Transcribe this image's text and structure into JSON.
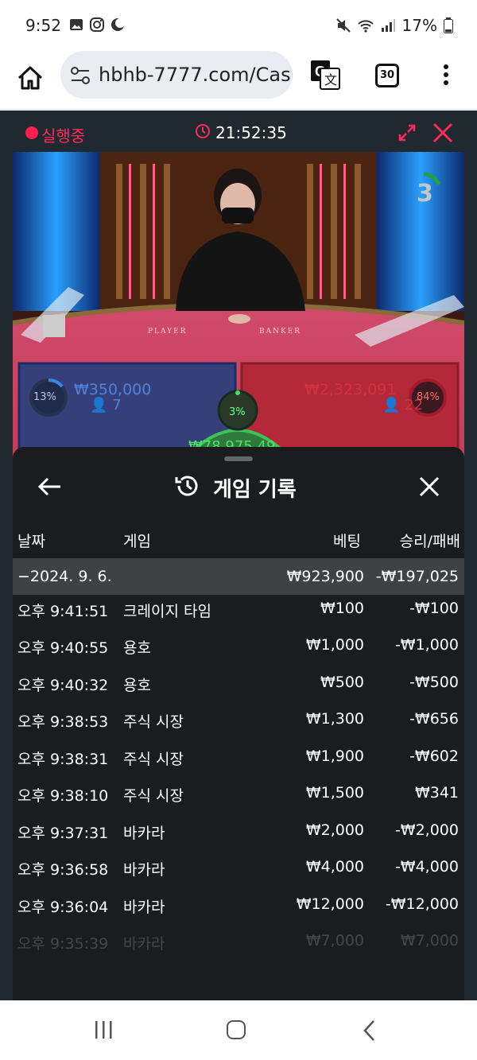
{
  "status_bar": {
    "time": "9:52",
    "battery": "17%",
    "icons": [
      "image-icon",
      "instagram-icon",
      "moon-icon",
      "mute-icon",
      "wifi-icon",
      "signal-icon",
      "battery-icon"
    ]
  },
  "browser": {
    "url": "hbhb-7777.com/Casi",
    "tab_count": "30"
  },
  "game": {
    "live_label": "실행중",
    "clock": "21:52:35",
    "countdown": "3",
    "player": {
      "pct": "13%",
      "amount": "₩350,000",
      "count": "7"
    },
    "banker": {
      "pct": "84%",
      "amount": "₩2,323,091",
      "count": "22"
    },
    "center": {
      "pct": "3%",
      "amount": "₩78,975.49"
    },
    "table_player": "PLAYER",
    "table_banker": "BANKER"
  },
  "panel": {
    "title": "게임 기록",
    "columns": {
      "date": "날짜",
      "game": "게임",
      "bet": "베팅",
      "result": "승리/패배"
    },
    "date_row": {
      "date": "−2024. 9. 6.",
      "bet": "₩923,900",
      "result": "-₩197,025"
    },
    "rows": [
      {
        "time": "오후 9:41:51",
        "game": "크레이지 타임",
        "bet": "₩100",
        "result": "-₩100"
      },
      {
        "time": "오후 9:40:55",
        "game": "용호",
        "bet": "₩1,000",
        "result": "-₩1,000"
      },
      {
        "time": "오후 9:40:32",
        "game": "용호",
        "bet": "₩500",
        "result": "-₩500"
      },
      {
        "time": "오후 9:38:53",
        "game": "주식 시장",
        "bet": "₩1,300",
        "result": "-₩656"
      },
      {
        "time": "오후 9:38:31",
        "game": "주식 시장",
        "bet": "₩1,900",
        "result": "-₩602"
      },
      {
        "time": "오후 9:38:10",
        "game": "주식 시장",
        "bet": "₩1,500",
        "result": "₩341"
      },
      {
        "time": "오후 9:37:31",
        "game": "바카라",
        "bet": "₩2,000",
        "result": "-₩2,000"
      },
      {
        "time": "오후 9:36:58",
        "game": "바카라",
        "bet": "₩4,000",
        "result": "-₩4,000"
      },
      {
        "time": "오후 9:36:04",
        "game": "바카라",
        "bet": "₩12,000",
        "result": "-₩12,000"
      },
      {
        "time": "오후 9:35:39",
        "game": "바카라",
        "bet": "₩7,000",
        "result": "₩7,000"
      }
    ]
  },
  "colors": {
    "accent": "#ff1f4f",
    "panel_bg": "#1b1c1d",
    "date_row_bg": "#404142",
    "player_blue": "#4f82db",
    "banker_red": "#d0343c",
    "tie_green": "#4ee06b"
  }
}
